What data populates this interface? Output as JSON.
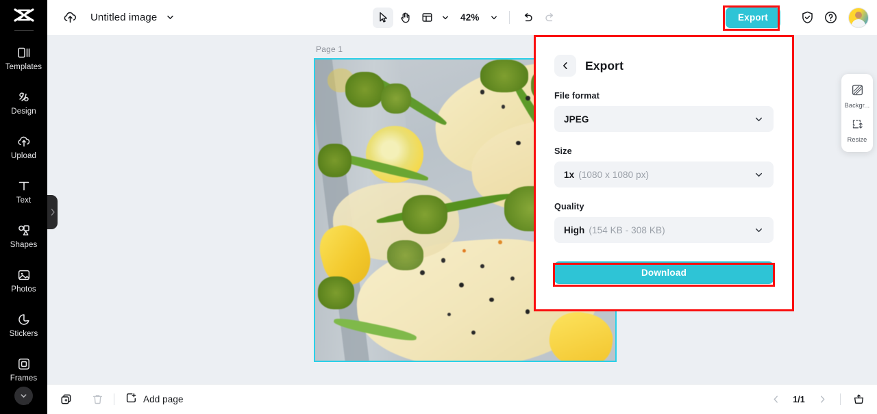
{
  "app": {
    "brand": "capcut-logo"
  },
  "sidebar": {
    "items": [
      {
        "label": "Templates",
        "icon": "templates-icon"
      },
      {
        "label": "Design",
        "icon": "design-icon"
      },
      {
        "label": "Upload",
        "icon": "upload-icon"
      },
      {
        "label": "Text",
        "icon": "text-icon"
      },
      {
        "label": "Shapes",
        "icon": "shapes-icon"
      },
      {
        "label": "Photos",
        "icon": "photos-icon"
      },
      {
        "label": "Stickers",
        "icon": "stickers-icon"
      },
      {
        "label": "Frames",
        "icon": "frames-icon"
      }
    ],
    "collapse_icon": "chevron-down-icon",
    "panel_handle_icon": "chevron-right-icon"
  },
  "topbar": {
    "cloud_icon": "cloud-upload-icon",
    "doc_title": "Untitled image",
    "doc_title_caret": "chevron-down-icon",
    "tools": {
      "select_icon": "cursor-arrow-icon",
      "hand_icon": "hand-icon",
      "layout_icon": "layout-grid-icon",
      "layout_caret": "chevron-down-icon",
      "zoom_value": "42%",
      "zoom_caret": "chevron-down-icon",
      "undo_icon": "undo-icon",
      "redo_icon": "redo-icon"
    },
    "export_label": "Export",
    "shield_icon": "shield-check-icon",
    "help_icon": "question-circle-icon",
    "avatar": "user-avatar"
  },
  "canvas": {
    "page_label": "Page 1",
    "artboard_alt": "baked-chicken-broccolini-lemon-photo"
  },
  "right_tools": [
    {
      "label": "Backgr...",
      "icon": "background-icon"
    },
    {
      "label": "Resize",
      "icon": "resize-icon"
    }
  ],
  "export_panel": {
    "back_icon": "chevron-left-icon",
    "title": "Export",
    "fields": [
      {
        "label": "File format",
        "value": "JPEG",
        "detail": "",
        "caret": "chevron-down-icon"
      },
      {
        "label": "Size",
        "value": "1x",
        "detail": "(1080 x 1080 px)",
        "caret": "chevron-down-icon"
      },
      {
        "label": "Quality",
        "value": "High",
        "detail": "(154 KB - 308 KB)",
        "caret": "chevron-down-icon"
      }
    ],
    "download_label": "Download"
  },
  "bottombar": {
    "duplicate_icon": "duplicate-page-icon",
    "delete_icon": "trash-icon",
    "add_page_icon": "add-page-icon",
    "add_page_label": "Add page",
    "prev_icon": "chevron-left-icon",
    "next_icon": "chevron-right-icon",
    "page_indicator": "1/1",
    "present_icon": "present-icon"
  },
  "colors": {
    "accent": "#2ec4d6",
    "highlight": "#fa0f0f",
    "selection": "#29d0e8",
    "sidebar_bg": "#000000",
    "canvas_bg": "#eceff3"
  }
}
